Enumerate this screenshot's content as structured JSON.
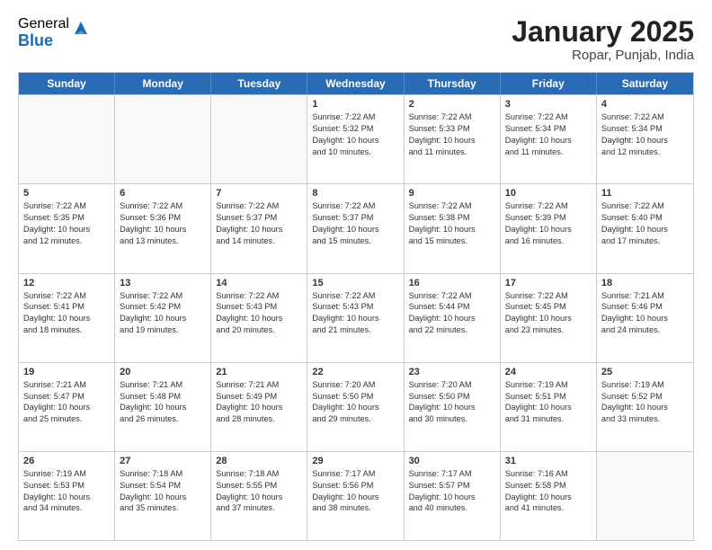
{
  "logo": {
    "general": "General",
    "blue": "Blue"
  },
  "title": "January 2025",
  "subtitle": "Ropar, Punjab, India",
  "headers": [
    "Sunday",
    "Monday",
    "Tuesday",
    "Wednesday",
    "Thursday",
    "Friday",
    "Saturday"
  ],
  "weeks": [
    [
      {
        "day": "",
        "lines": [],
        "empty": true
      },
      {
        "day": "",
        "lines": [],
        "empty": true
      },
      {
        "day": "",
        "lines": [],
        "empty": true
      },
      {
        "day": "1",
        "lines": [
          "Sunrise: 7:22 AM",
          "Sunset: 5:32 PM",
          "Daylight: 10 hours",
          "and 10 minutes."
        ]
      },
      {
        "day": "2",
        "lines": [
          "Sunrise: 7:22 AM",
          "Sunset: 5:33 PM",
          "Daylight: 10 hours",
          "and 11 minutes."
        ]
      },
      {
        "day": "3",
        "lines": [
          "Sunrise: 7:22 AM",
          "Sunset: 5:34 PM",
          "Daylight: 10 hours",
          "and 11 minutes."
        ]
      },
      {
        "day": "4",
        "lines": [
          "Sunrise: 7:22 AM",
          "Sunset: 5:34 PM",
          "Daylight: 10 hours",
          "and 12 minutes."
        ]
      }
    ],
    [
      {
        "day": "5",
        "lines": [
          "Sunrise: 7:22 AM",
          "Sunset: 5:35 PM",
          "Daylight: 10 hours",
          "and 12 minutes."
        ]
      },
      {
        "day": "6",
        "lines": [
          "Sunrise: 7:22 AM",
          "Sunset: 5:36 PM",
          "Daylight: 10 hours",
          "and 13 minutes."
        ]
      },
      {
        "day": "7",
        "lines": [
          "Sunrise: 7:22 AM",
          "Sunset: 5:37 PM",
          "Daylight: 10 hours",
          "and 14 minutes."
        ]
      },
      {
        "day": "8",
        "lines": [
          "Sunrise: 7:22 AM",
          "Sunset: 5:37 PM",
          "Daylight: 10 hours",
          "and 15 minutes."
        ]
      },
      {
        "day": "9",
        "lines": [
          "Sunrise: 7:22 AM",
          "Sunset: 5:38 PM",
          "Daylight: 10 hours",
          "and 15 minutes."
        ]
      },
      {
        "day": "10",
        "lines": [
          "Sunrise: 7:22 AM",
          "Sunset: 5:39 PM",
          "Daylight: 10 hours",
          "and 16 minutes."
        ]
      },
      {
        "day": "11",
        "lines": [
          "Sunrise: 7:22 AM",
          "Sunset: 5:40 PM",
          "Daylight: 10 hours",
          "and 17 minutes."
        ]
      }
    ],
    [
      {
        "day": "12",
        "lines": [
          "Sunrise: 7:22 AM",
          "Sunset: 5:41 PM",
          "Daylight: 10 hours",
          "and 18 minutes."
        ]
      },
      {
        "day": "13",
        "lines": [
          "Sunrise: 7:22 AM",
          "Sunset: 5:42 PM",
          "Daylight: 10 hours",
          "and 19 minutes."
        ]
      },
      {
        "day": "14",
        "lines": [
          "Sunrise: 7:22 AM",
          "Sunset: 5:43 PM",
          "Daylight: 10 hours",
          "and 20 minutes."
        ]
      },
      {
        "day": "15",
        "lines": [
          "Sunrise: 7:22 AM",
          "Sunset: 5:43 PM",
          "Daylight: 10 hours",
          "and 21 minutes."
        ]
      },
      {
        "day": "16",
        "lines": [
          "Sunrise: 7:22 AM",
          "Sunset: 5:44 PM",
          "Daylight: 10 hours",
          "and 22 minutes."
        ]
      },
      {
        "day": "17",
        "lines": [
          "Sunrise: 7:22 AM",
          "Sunset: 5:45 PM",
          "Daylight: 10 hours",
          "and 23 minutes."
        ]
      },
      {
        "day": "18",
        "lines": [
          "Sunrise: 7:21 AM",
          "Sunset: 5:46 PM",
          "Daylight: 10 hours",
          "and 24 minutes."
        ]
      }
    ],
    [
      {
        "day": "19",
        "lines": [
          "Sunrise: 7:21 AM",
          "Sunset: 5:47 PM",
          "Daylight: 10 hours",
          "and 25 minutes."
        ]
      },
      {
        "day": "20",
        "lines": [
          "Sunrise: 7:21 AM",
          "Sunset: 5:48 PM",
          "Daylight: 10 hours",
          "and 26 minutes."
        ]
      },
      {
        "day": "21",
        "lines": [
          "Sunrise: 7:21 AM",
          "Sunset: 5:49 PM",
          "Daylight: 10 hours",
          "and 28 minutes."
        ]
      },
      {
        "day": "22",
        "lines": [
          "Sunrise: 7:20 AM",
          "Sunset: 5:50 PM",
          "Daylight: 10 hours",
          "and 29 minutes."
        ]
      },
      {
        "day": "23",
        "lines": [
          "Sunrise: 7:20 AM",
          "Sunset: 5:50 PM",
          "Daylight: 10 hours",
          "and 30 minutes."
        ]
      },
      {
        "day": "24",
        "lines": [
          "Sunrise: 7:19 AM",
          "Sunset: 5:51 PM",
          "Daylight: 10 hours",
          "and 31 minutes."
        ]
      },
      {
        "day": "25",
        "lines": [
          "Sunrise: 7:19 AM",
          "Sunset: 5:52 PM",
          "Daylight: 10 hours",
          "and 33 minutes."
        ]
      }
    ],
    [
      {
        "day": "26",
        "lines": [
          "Sunrise: 7:19 AM",
          "Sunset: 5:53 PM",
          "Daylight: 10 hours",
          "and 34 minutes."
        ]
      },
      {
        "day": "27",
        "lines": [
          "Sunrise: 7:18 AM",
          "Sunset: 5:54 PM",
          "Daylight: 10 hours",
          "and 35 minutes."
        ]
      },
      {
        "day": "28",
        "lines": [
          "Sunrise: 7:18 AM",
          "Sunset: 5:55 PM",
          "Daylight: 10 hours",
          "and 37 minutes."
        ]
      },
      {
        "day": "29",
        "lines": [
          "Sunrise: 7:17 AM",
          "Sunset: 5:56 PM",
          "Daylight: 10 hours",
          "and 38 minutes."
        ]
      },
      {
        "day": "30",
        "lines": [
          "Sunrise: 7:17 AM",
          "Sunset: 5:57 PM",
          "Daylight: 10 hours",
          "and 40 minutes."
        ]
      },
      {
        "day": "31",
        "lines": [
          "Sunrise: 7:16 AM",
          "Sunset: 5:58 PM",
          "Daylight: 10 hours",
          "and 41 minutes."
        ]
      },
      {
        "day": "",
        "lines": [],
        "empty": true
      }
    ]
  ]
}
